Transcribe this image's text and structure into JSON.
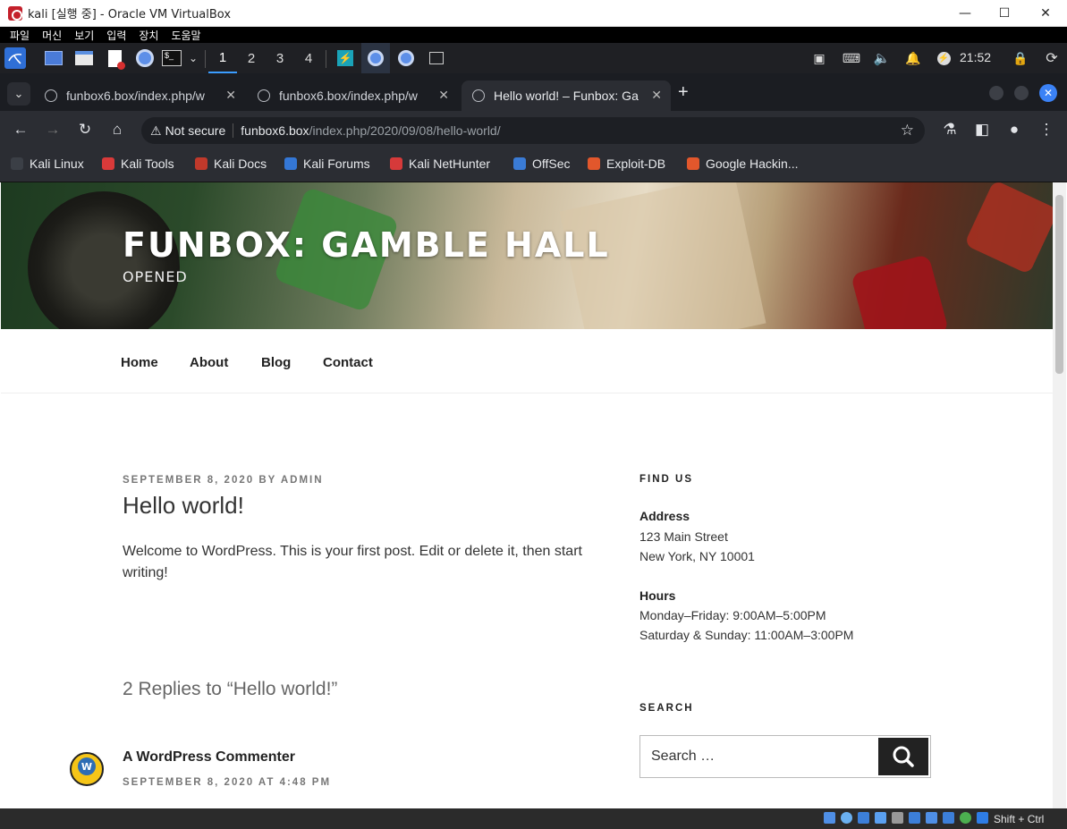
{
  "window": {
    "title": "kali [실행 중] - Oracle VM VirtualBox",
    "minimize": "—",
    "maximize": "☐",
    "close": "✕"
  },
  "vbox_menu": [
    "파일",
    "머신",
    "보기",
    "입력",
    "장치",
    "도움말"
  ],
  "kali_panel": {
    "workspaces": [
      "1",
      "2",
      "3",
      "4"
    ],
    "active_workspace": "1",
    "clock": "21:52"
  },
  "browser": {
    "tabs": [
      {
        "label": "funbox6.box/index.php/w",
        "active": false
      },
      {
        "label": "funbox6.box/index.php/w",
        "active": false
      },
      {
        "label": "Hello world! – Funbox: Ga",
        "active": true
      }
    ],
    "new_tab": "+",
    "address": {
      "security": "Not secure",
      "host": "funbox6.box",
      "path": "/index.php/2020/09/08/hello-world/"
    },
    "bookmarks": [
      {
        "label": "Kali Linux",
        "color": "#3b3f46"
      },
      {
        "label": "Kali Tools",
        "color": "#d93a3a"
      },
      {
        "label": "Kali Docs",
        "color": "#c0392b"
      },
      {
        "label": "Kali Forums",
        "color": "#3477d6"
      },
      {
        "label": "Kali NetHunter",
        "color": "#d63a3a"
      },
      {
        "label": "OffSec",
        "color": "#3a7bd5"
      },
      {
        "label": "Exploit-DB",
        "color": "#e2572c"
      },
      {
        "label": "Google Hackin...",
        "color": "#e2572c"
      }
    ]
  },
  "site": {
    "title": "FUNBOX: GAMBLE HALL",
    "tagline": "OPENED",
    "nav": [
      "Home",
      "About",
      "Blog",
      "Contact"
    ]
  },
  "post": {
    "meta": "SEPTEMBER 8, 2020 BY ADMIN",
    "title": "Hello world!",
    "body": "Welcome to WordPress. This is your first post. Edit or delete it, then start writing!",
    "replies_heading": "2 Replies to “Hello world!”",
    "comment": {
      "author": "A WordPress Commenter",
      "date": "SEPTEMBER 8, 2020 AT 4:48 PM"
    }
  },
  "sidebar": {
    "find_us": "FIND US",
    "address_label": "Address",
    "address_line1": "123 Main Street",
    "address_line2": "New York, NY 10001",
    "hours_label": "Hours",
    "hours_line1": "Monday–Friday: 9:00AM–5:00PM",
    "hours_line2": "Saturday & Sunday: 11:00AM–3:00PM",
    "search_heading": "SEARCH",
    "search_placeholder": "Search …"
  },
  "vbox_status": {
    "host_key": "Shift + Ctrl"
  }
}
